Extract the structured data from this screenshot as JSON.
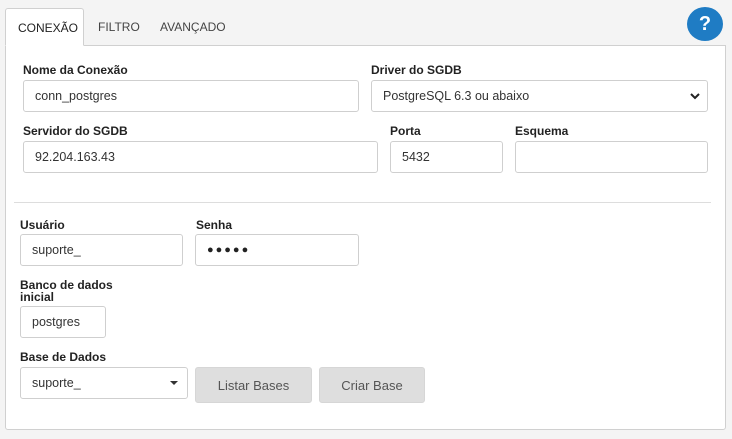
{
  "tabs": [
    {
      "label": "CONEXÃO",
      "active": true
    },
    {
      "label": "FILTRO",
      "active": false
    },
    {
      "label": "AVANÇADO",
      "active": false
    }
  ],
  "help": {
    "label": "?"
  },
  "connection": {
    "name_label": "Nome da Conexão",
    "name_value": "conn_postgres",
    "driver_label": "Driver do SGDB",
    "driver_value": "PostgreSQL 6.3 ou abaixo",
    "server_label": "Servidor do SGDB",
    "server_value": "92.204.163.43",
    "port_label": "Porta",
    "port_value": "5432",
    "schema_label": "Esquema",
    "schema_value": ""
  },
  "auth": {
    "user_label": "Usuário",
    "user_value": "suporte_",
    "password_label": "Senha",
    "password_value": "●●●●●"
  },
  "database": {
    "initial_label_line1": "Banco de dados",
    "initial_label_line2": "inicial",
    "initial_value": "postgres",
    "base_label": "Base de Dados",
    "base_value": "suporte_",
    "list_button": "Listar Bases",
    "create_button": "Criar Base"
  },
  "colors": {
    "accent": "#1f7cc4",
    "button_bg": "#dedede"
  }
}
